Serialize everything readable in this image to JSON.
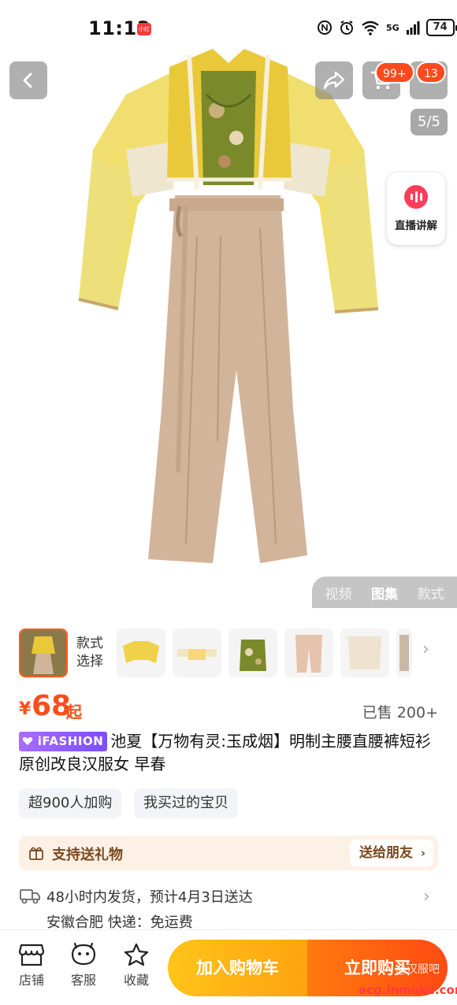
{
  "status_bar": {
    "time": "11:13",
    "app_badge": "小红书",
    "network": "5G",
    "battery": "74"
  },
  "header": {
    "cart_badge": "99+",
    "message_badge": "13",
    "image_counter": "5/5"
  },
  "live": {
    "label": "直播讲解"
  },
  "media_tabs": [
    {
      "label": "视频",
      "active": false
    },
    {
      "label": "图集",
      "active": true
    },
    {
      "label": "款式",
      "active": false
    }
  ],
  "styles": {
    "select_label_line1": "款式",
    "select_label_line2": "选择"
  },
  "price": {
    "symbol": "¥",
    "value": "68",
    "suffix": "起",
    "sold": "已售 200+"
  },
  "title": {
    "brand": "iFASHION",
    "text": "池夏【万物有灵:玉成烟】明制主腰直腰裤短衫原创改良汉服女 早春"
  },
  "chips": [
    "超900人加购",
    "我买过的宝贝"
  ],
  "gift": {
    "label": "支持送礼物",
    "button": "送给朋友",
    "chevron": "›"
  },
  "shipping": {
    "line1": "48小时内发货，预计4月3日送达",
    "line2": "安徽合肥  快递：免运费"
  },
  "bottom_nav": {
    "shop": "店铺",
    "service": "客服",
    "favorite": "收藏",
    "add_to_cart": "加入购物车",
    "buy_now": "立即购买"
  },
  "watermark": {
    "site": "acg.inmoke.com",
    "account": "@汉服吧"
  },
  "colors": {
    "accent": "#ff4d1a",
    "cart_button": "#ffb314",
    "buy_button": "#ff5a12",
    "brand_badge": "#8f5cff",
    "gift_bg": "#fdf1e6"
  }
}
